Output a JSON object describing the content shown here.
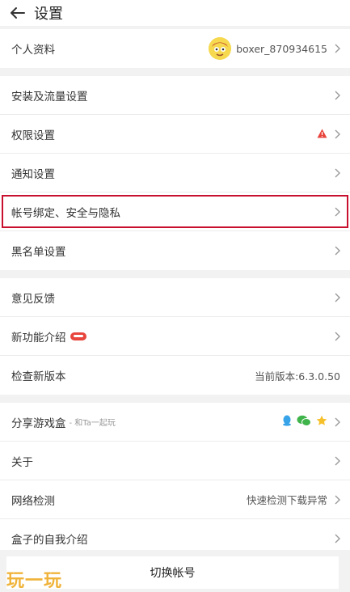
{
  "header": {
    "title": "设置"
  },
  "groups": [
    {
      "rows": [
        {
          "label": "个人资料",
          "value": "boxer_870934615"
        }
      ]
    },
    {
      "rows": [
        {
          "label": "安装及流量设置"
        },
        {
          "label": "权限设置"
        },
        {
          "label": "通知设置"
        },
        {
          "label": "帐号绑定、安全与隐私"
        },
        {
          "label": "黑名单设置"
        }
      ]
    },
    {
      "rows": [
        {
          "label": "意见反馈"
        },
        {
          "label": "新功能介绍"
        },
        {
          "label": "检查新版本",
          "value": "当前版本:6.3.0.50"
        }
      ]
    },
    {
      "rows": [
        {
          "label": "分享游戏盒",
          "sub": "- 和Ta一起玩"
        },
        {
          "label": "关于"
        },
        {
          "label": "网络检测",
          "value": "快速检测下载异常"
        },
        {
          "label": "盒子的自我介绍"
        }
      ]
    }
  ],
  "switch_account": "切换帐号",
  "watermark": "玩一玩",
  "colors": {
    "highlight": "#c8102e",
    "warning": "#e8453c",
    "accent": "#f0b33a"
  }
}
